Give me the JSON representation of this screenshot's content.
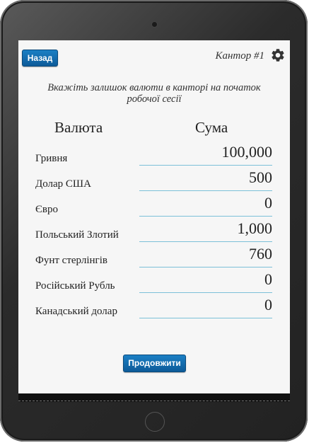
{
  "header": {
    "back_label": "Назад",
    "title": "Кантор #1",
    "settings_icon": "gear-icon"
  },
  "instruction": "Вкажіть залишок валюти в канторі на початок робочої сесії",
  "columns": {
    "currency": "Валюта",
    "amount": "Сума"
  },
  "rows": [
    {
      "label": "Гривня",
      "value": "100,000"
    },
    {
      "label": "Долар США",
      "value": "500"
    },
    {
      "label": "Євро",
      "value": "0"
    },
    {
      "label": "Польський Злотий",
      "value": "1,000"
    },
    {
      "label": "Фунт стерлінгів",
      "value": "760"
    },
    {
      "label": "Російський Рубль",
      "value": "0"
    },
    {
      "label": "Канадський долар",
      "value": "0"
    }
  ],
  "continue_label": "Продовжити",
  "colors": {
    "button_blue": "#0d5b99",
    "input_underline": "#7cc0d8",
    "screen_bg": "#f6f6f6"
  }
}
